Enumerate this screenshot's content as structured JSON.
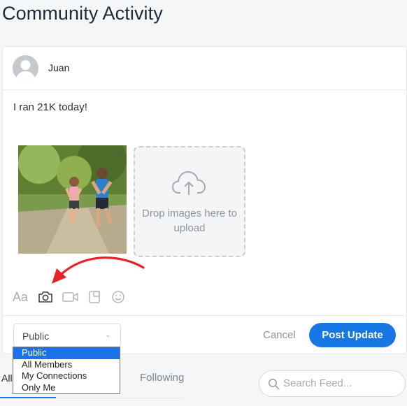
{
  "page": {
    "title": "Community Activity"
  },
  "composer": {
    "user_name": "Juan",
    "post_text": "I ran 21K today!",
    "thumbnail_remove_label": "×",
    "dropzone_text": "Drop images here to upload",
    "toolbar": {
      "text_format_label": "Aa",
      "icons": [
        "text-format-icon",
        "camera-icon",
        "video-icon",
        "poll-icon",
        "emoji-icon"
      ]
    },
    "privacy": {
      "selected": "Public",
      "options": [
        "Public",
        "All Members",
        "My Connections",
        "Only Me"
      ]
    },
    "cancel_label": "Cancel",
    "post_label": "Post Update"
  },
  "feed": {
    "tabs": [
      {
        "label": "All"
      },
      {
        "label": "Following"
      }
    ],
    "search": {
      "placeholder": "Search Feed..."
    }
  },
  "colors": {
    "accent": "#1677e5",
    "annotation": "#e8212a",
    "dropdown_highlight": "#1a73e8"
  }
}
